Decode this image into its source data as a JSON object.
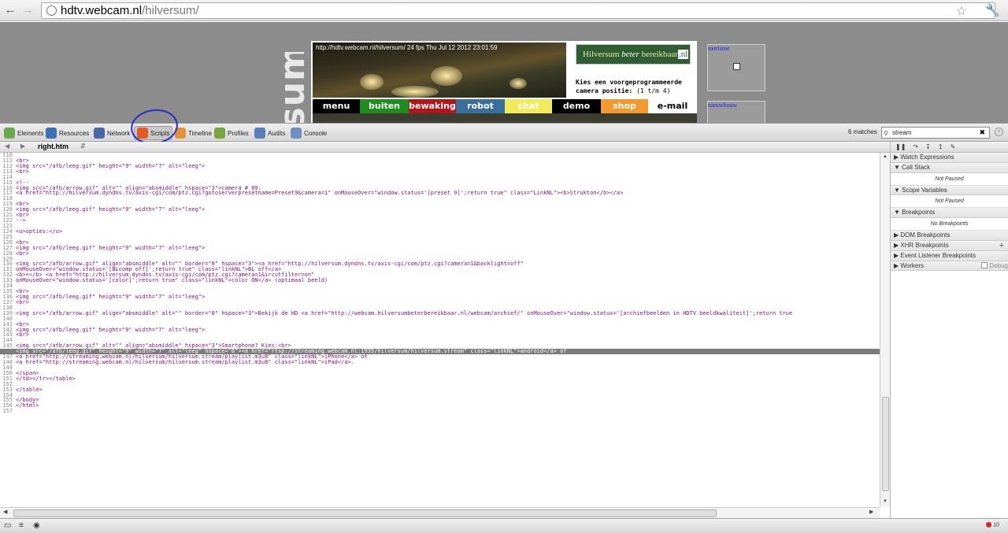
{
  "browser": {
    "url_host": "hdtv.webcam.nl",
    "url_path": "/hilversum/"
  },
  "page": {
    "site_word": "ersum",
    "cam_timestamp": "http://hdtv.webcam.nl/hilversum/ 24 fps Thu Jul 12 2012 23:01:59",
    "banner": {
      "left": "Hilversum",
      "mid": "beter",
      "right": "bereikbaar",
      "nl": ".nl"
    },
    "camera_position": {
      "line1": "Kies een voorgeprogrammeerde",
      "line2": "camera positie:",
      "line2b": "(1 t/m 4)"
    },
    "menu": [
      {
        "label": "menu",
        "bg": "#000000",
        "fg": "#ffffff"
      },
      {
        "label": "buiten",
        "bg": "#1e8c1e",
        "fg": "#ffffff"
      },
      {
        "label": "bewaking",
        "bg": "#b3151b",
        "fg": "#ffffff"
      },
      {
        "label": "robot",
        "bg": "#3a6f9c",
        "fg": "#ffffff"
      },
      {
        "label": "chat",
        "bg": "#f1ea5a",
        "fg": "#ffffff"
      },
      {
        "label": "demo",
        "bg": "#000000",
        "fg": "#ffffff"
      },
      {
        "label": "shop",
        "bg": "#f39a2e",
        "fg": "#ffffff"
      },
      {
        "label": "e-mail",
        "bg": "#ffffff",
        "fg": "#000000"
      }
    ],
    "side_boxes": [
      "toerisme",
      "nieuwbouw"
    ]
  },
  "devtools": {
    "tabs": [
      {
        "label": "Elements",
        "color": "#6aa84f"
      },
      {
        "label": "Resources",
        "color": "#3d6fb5"
      },
      {
        "label": "Network",
        "color": "#4a67a8"
      },
      {
        "label": "Scripts",
        "color": "#e25a27"
      },
      {
        "label": "Timeline",
        "color": "#e69138"
      },
      {
        "label": "Profiles",
        "color": "#7aa43f"
      },
      {
        "label": "Audits",
        "color": "#5a7fb8"
      },
      {
        "label": "Console",
        "color": "#6e8fbf"
      }
    ],
    "matches": "6 matches",
    "search_value": "stream",
    "file_name": "right.htm",
    "code_lines": [
      {
        "n": "110",
        "t": ""
      },
      {
        "n": "111",
        "t": "<br>"
      },
      {
        "n": "112",
        "t": "<img src=\"/afb/leeg.gif\" height=\"9\" width=\"7\" alt=\"leeg\">"
      },
      {
        "n": "113",
        "t": "<br>"
      },
      {
        "n": "114",
        "t": ""
      },
      {
        "n": "115",
        "t": "<!--"
      },
      {
        "n": "116",
        "t": "<img src=\"/afb/arrow.gif\" alt=\"\" align=\"absmiddle\" hspace=\"3\">camera # 09:"
      },
      {
        "n": "117",
        "t": "<a href=\"http://hilversum.dyndns.tv/axis-cgi/com/ptz.cgi?gotoserverpresetname=Preset9&camera=1\" onMouseOver=\"window.status='[preset 9]';return true\" class=\"LinkNL\"><b>Strukton</b></a>"
      },
      {
        "n": "118",
        "t": ""
      },
      {
        "n": "119",
        "t": "<br>"
      },
      {
        "n": "120",
        "t": "<img src=\"/afb/leeg.gif\" height=\"9\" width=\"7\" alt=\"leeg\">"
      },
      {
        "n": "121",
        "t": "<br>"
      },
      {
        "n": "122",
        "t": "-->"
      },
      {
        "n": "123",
        "t": ""
      },
      {
        "n": "124",
        "t": "<u>opties:</u>"
      },
      {
        "n": "125",
        "t": ""
      },
      {
        "n": "126",
        "t": "<br>"
      },
      {
        "n": "127",
        "t": "<img src=\"/afb/leeg.gif\" height=\"9\" width=\"7\" alt=\"leeg\">"
      },
      {
        "n": "128",
        "t": "<br>"
      },
      {
        "n": "129",
        "t": ""
      },
      {
        "n": "130",
        "t": "<img src=\"/afb/arrow.gif\" align=\"absmiddle\" alt=\"\" border=\"0\" hspace=\"3\"><a href=\"http://hilversum.dyndns.tv/axis-cgi/com/ptz.cgi?camera=1&backlight=off\""
      },
      {
        "n": "131",
        "t": "onMouseOver=\"window.status='[BLcomp off]';return true\" class=\"linkNL\">BL off</a>"
      },
      {
        "n": "132",
        "t": "<b>+</b> <a href=\"http://hilversum.dyndns.tv/axis-cgi/com/ptz.cgi?camera=1&ircutfilter=on\""
      },
      {
        "n": "133",
        "t": "onMouseOver=\"window.status='[color]';return true\" class=\"linkNL\">color ON</a> (optimaal beeld)"
      },
      {
        "n": "134",
        "t": ""
      },
      {
        "n": "135",
        "t": "<br>"
      },
      {
        "n": "136",
        "t": "<img src=\"/afb/leeg.gif\" height=\"9\" width=\"7\" alt=\"leeg\">"
      },
      {
        "n": "137",
        "t": "<br>"
      },
      {
        "n": "138",
        "t": ""
      },
      {
        "n": "139",
        "t": "<img src=\"/afb/arrow.gif\" align=\"absmiddle\" alt=\"\" border=\"0\" hspace=\"3\">Bekijk de HD <a href=\"http://webcam.hilversumbeterbereikbaar.nl/webcam/archief/\" onMouseOver=\"window.status='[archiefbeelden in HDTV beeldkwaliteit]';return true"
      },
      {
        "n": "140",
        "t": ""
      },
      {
        "n": "141",
        "t": "<br>"
      },
      {
        "n": "142",
        "t": "<img src=\"/afb/leeg.gif\" height=\"9\" width=\"7\" alt=\"leeg\">"
      },
      {
        "n": "143",
        "t": "<br>"
      },
      {
        "n": "144",
        "t": ""
      },
      {
        "n": "145",
        "t": "<img src=\"/afb/arrow.gif\" alt=\"\" align=\"absmiddle\" hspace=\"3\">Smartphone? Kies:<br>"
      },
      {
        "n": "146",
        "t": "<img src=\"/afb/leeg.gif\" height=\"9\" width=\"7\" alt=\"leeg\" hspace=\"6\"><a href=\"rtsp://streaming.webcam.nl:1935/hilversum/hilversum.stream\" class=\"linkNL\">android</a> of",
        "hl": true
      },
      {
        "n": "147",
        "t": "<a href=\"http://streaming.webcam.nl/hilversum/hilversum.stream/playlist.m3u8\" class=\"linkNL\">iPhone</a> of"
      },
      {
        "n": "148",
        "t": "<a href=\"http://streaming.webcam.nl/hilversum/hilversum.stream/playlist.m3u8\" class=\"linkNL\">iPad</a>."
      },
      {
        "n": "149",
        "t": ""
      },
      {
        "n": "150",
        "t": "</span>"
      },
      {
        "n": "151",
        "t": "</td></tr></table>"
      },
      {
        "n": "152",
        "t": ""
      },
      {
        "n": "153",
        "t": "</table>"
      },
      {
        "n": "154",
        "t": ""
      },
      {
        "n": "155",
        "t": "</body>"
      },
      {
        "n": "156",
        "t": "</html>"
      },
      {
        "n": "157",
        "t": ""
      }
    ],
    "sidebar": {
      "watch": "Watch Expressions",
      "call_stack": "Call Stack",
      "call_stack_body": "Not Paused",
      "scope": "Scope Variables",
      "scope_body": "Not Paused",
      "breakpoints": "Breakpoints",
      "breakpoints_body": "No Breakpoints",
      "dom_bp": "DOM Breakpoints",
      "xhr_bp": "XHR Breakpoints",
      "event_bp": "Event Listener Breakpoints",
      "workers": "Workers",
      "debug_label": "Debug"
    },
    "error_count": "10"
  }
}
